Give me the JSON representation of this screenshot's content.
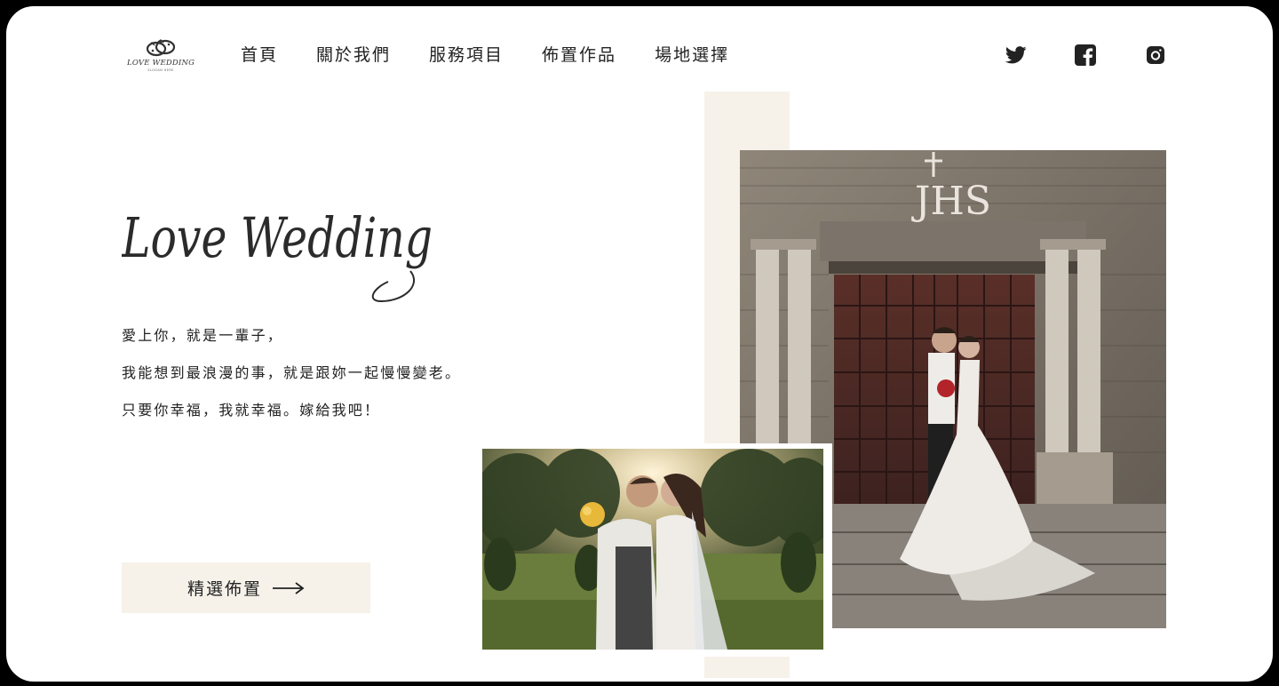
{
  "logo": {
    "icon": "double-rings-icon",
    "text": "LOVE WEDDING",
    "slogan": "SLOGAN HERE"
  },
  "nav": {
    "items": [
      {
        "label": "首頁"
      },
      {
        "label": "關於我們"
      },
      {
        "label": "服務項目"
      },
      {
        "label": "佈置作品"
      },
      {
        "label": "場地選擇"
      }
    ]
  },
  "social": {
    "icons": [
      "twitter-icon",
      "facebook-icon",
      "instagram-icon"
    ]
  },
  "hero": {
    "title": "Love Wedding",
    "lines": [
      "愛上你，就是一輩子，",
      "我能想到最浪漫的事，就是跟妳一起慢慢變老。",
      "只要你幸福，我就幸福。嫁給我吧！"
    ],
    "cta_label": "精選佈置",
    "cta_icon": "arrow-right-icon"
  },
  "photos": {
    "church_inscription": "JHS"
  },
  "colors": {
    "accent_beige": "#f6f2ea",
    "text": "#222222"
  }
}
